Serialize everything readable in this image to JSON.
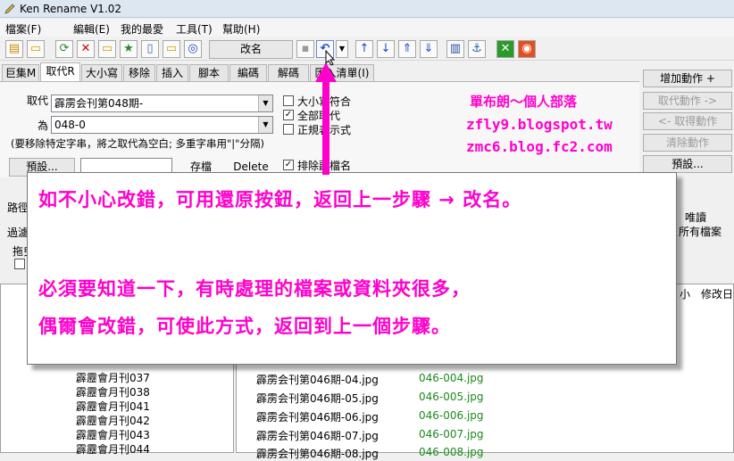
{
  "window": {
    "title": "Ken Rename V1.02"
  },
  "menu": [
    "檔案(F)",
    "編輯(E)",
    "我的最愛",
    "工具(T)",
    "幫助(H)"
  ],
  "toolbar": {
    "rename_label": "改名"
  },
  "tabs": [
    "巨集M",
    "取代R",
    "大小寫",
    "移除",
    "插入",
    "腳本",
    "編碼",
    "解碼",
    "匯入清單(I)"
  ],
  "replace_panel": {
    "replace_label": "取代",
    "replace_value": "霹雳会刊第048期-",
    "with_label": "為",
    "with_value": "048-0",
    "hint": "(要移除特定字串，將之取代為空白; 多重字串用\"|\"分隔)",
    "preset_button": "預設...",
    "save_button": "存檔",
    "delete_button": "Delete",
    "options": [
      {
        "label": "大小寫符合",
        "checked": false
      },
      {
        "label": "全部取代",
        "checked": true
      },
      {
        "label": "正規表示式",
        "checked": false
      }
    ],
    "exclude_ext": {
      "label": "排除副檔名",
      "checked": true
    }
  },
  "actions": {
    "add": "增加動作 +",
    "cancel": "取代動作 ->",
    "retrieve": "<- 取得動作",
    "clear": "清除動作",
    "preset": "預設..."
  },
  "blog": {
    "title": "單布朗～個人部落",
    "url1": "zfly9.blogspot.tw",
    "url2": "zmc6.blog.fc2.com"
  },
  "lower": {
    "path_label": "路徑",
    "filter_label": "過濾",
    "drag_label": "拖曳",
    "right1": "唯讀",
    "right2": "所有檔案",
    "col_size": "小",
    "col_modified": "修改日"
  },
  "tree": [
    "霹靂會月刊037",
    "霹靂會月刊038",
    "霹靂會月刊041",
    "霹靂會月刊042",
    "霹靂會月刊043",
    "霹靂會月刊044"
  ],
  "files": [
    {
      "name": "霹雳会刊第046期-04.jpg",
      "new": "046-004.jpg"
    },
    {
      "name": "霹雳会刊第046期-05.jpg",
      "new": "046-005.jpg"
    },
    {
      "name": "霹雳会刊第046期-06.jpg",
      "new": "046-006.jpg"
    },
    {
      "name": "霹雳会刊第046期-07.jpg",
      "new": "046-007.jpg"
    },
    {
      "name": "霹雳会刊第046期-08.jpg",
      "new": "046-008.jpg"
    }
  ],
  "callout": {
    "line1": "如不小心改錯，可用還原按鈕，返回上一步驟 → 改名。",
    "line2": "必須要知道一下，有時處理的檔案或資料夾很多，",
    "line3": "偶爾會改錯，可使此方式，返回到上一個步驟。"
  },
  "colors": {
    "accent": "#ff00cc",
    "green_text": "#1c8a1c"
  }
}
